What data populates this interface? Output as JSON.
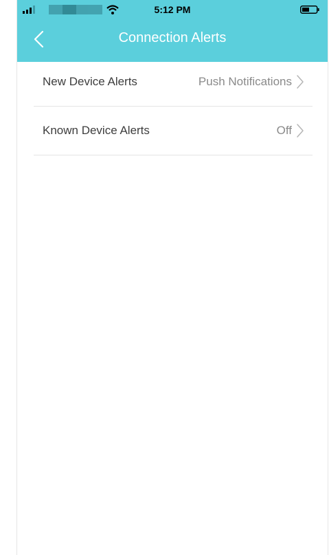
{
  "status_bar": {
    "time": "5:12 PM"
  },
  "nav": {
    "title": "Connection Alerts",
    "back_icon": "chevron-left-icon"
  },
  "settings": [
    {
      "label": "New Device Alerts",
      "value": "Push Notifications"
    },
    {
      "label": "Known Device Alerts",
      "value": "Off"
    }
  ],
  "colors": {
    "header": "#5bcfdc",
    "label": "#3d3d3d",
    "value": "#8a8a8a"
  }
}
